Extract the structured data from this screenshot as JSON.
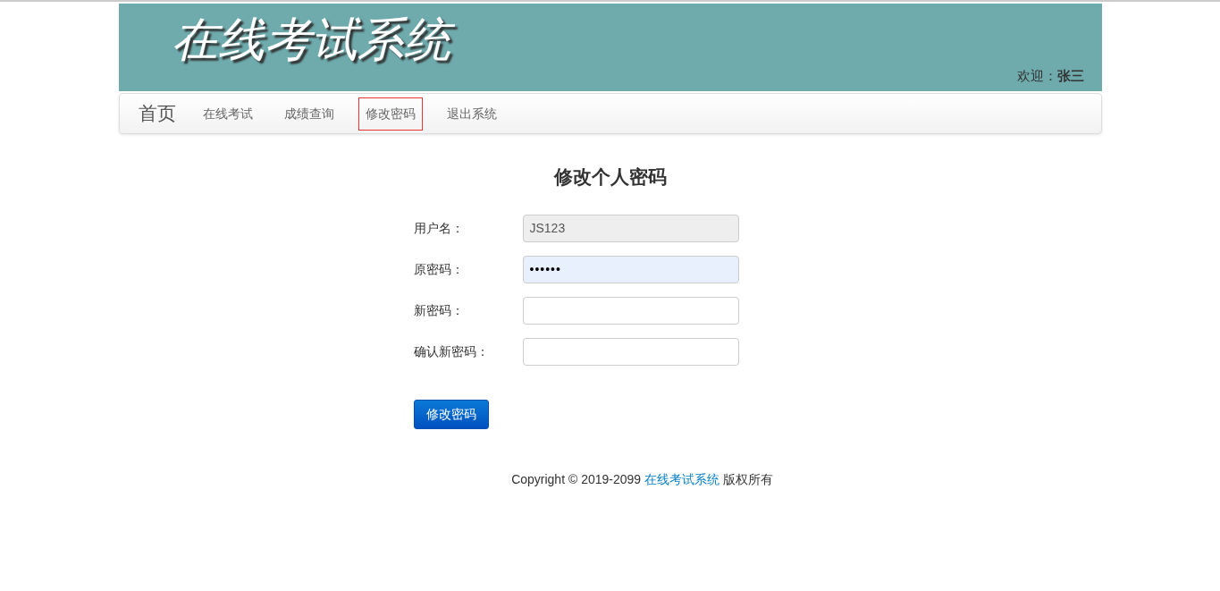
{
  "header": {
    "title": "在线考试系统",
    "welcome": "欢迎：**张三**"
  },
  "nav": {
    "brand": "首页",
    "items": [
      {
        "label": "在线考试",
        "selected": false
      },
      {
        "label": "成绩查询",
        "selected": false
      },
      {
        "label": "修改密码",
        "selected": true
      },
      {
        "label": "退出系统",
        "selected": false
      }
    ]
  },
  "form": {
    "title": "修改个人密码",
    "fields": [
      {
        "label": "用户名：",
        "value": "JS123",
        "kind": "readonly"
      },
      {
        "label": "原密码：",
        "value": "••••••",
        "kind": "autofilled"
      },
      {
        "label": "新密码：",
        "kind": "plain"
      },
      {
        "label": "确认新密码：",
        "kind": "plain"
      }
    ],
    "submit": "修改密码"
  },
  "footer": {
    "before": "Copyright © 2019-2099",
    "link": "在线考试系统",
    "after": "版权所有"
  }
}
